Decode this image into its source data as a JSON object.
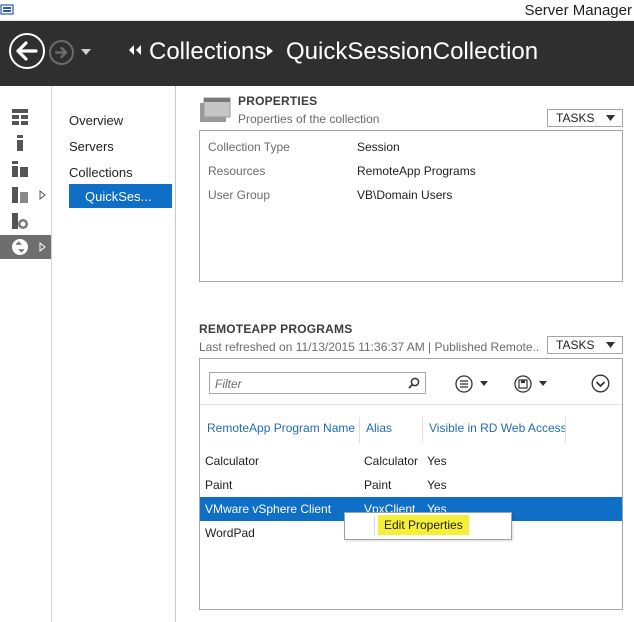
{
  "window": {
    "title": "Server Manager"
  },
  "breadcrumb": {
    "items": [
      "Collections",
      "QuickSessionCollection"
    ]
  },
  "nav": {
    "items": [
      "Overview",
      "Servers",
      "Collections"
    ],
    "selected": "QuickSes..."
  },
  "properties": {
    "title": "PROPERTIES",
    "subtitle": "Properties of the collection",
    "tasks_label": "TASKS",
    "rows": [
      {
        "key": "Collection Type",
        "value": "Session"
      },
      {
        "key": "Resources",
        "value": "RemoteApp Programs"
      },
      {
        "key": "User Group",
        "value": "VB\\Domain Users"
      }
    ]
  },
  "remoteapp": {
    "title": "REMOTEAPP PROGRAMS",
    "subtitle": "Last refreshed on 11/13/2015 11:36:37 AM | Published Remote...",
    "tasks_label": "TASKS",
    "filter_placeholder": "Filter",
    "columns": [
      "RemoteApp Program Name",
      "Alias",
      "Visible in RD Web Access"
    ],
    "rows": [
      {
        "name": "Calculator",
        "alias": "Calculator",
        "visible": "Yes"
      },
      {
        "name": "Paint",
        "alias": "Paint",
        "visible": "Yes"
      },
      {
        "name": "VMware vSphere Client",
        "alias": "VpxClient",
        "visible": "Yes"
      },
      {
        "name": "WordPad",
        "alias": "",
        "visible": ""
      }
    ],
    "selected_row": 2
  },
  "context_menu": {
    "items": [
      "Edit Properties"
    ],
    "highlight_color": "#f5ef3a"
  },
  "colors": {
    "header_bg": "#2f2f2f",
    "selection": "#0f6ec6",
    "link_blue": "#1f6cb7"
  },
  "icons": {
    "rail": [
      "dashboard-icon",
      "local-server-icon",
      "all-servers-icon",
      "file-storage-icon",
      "iis-icon",
      "remote-desktop-services-icon"
    ]
  }
}
